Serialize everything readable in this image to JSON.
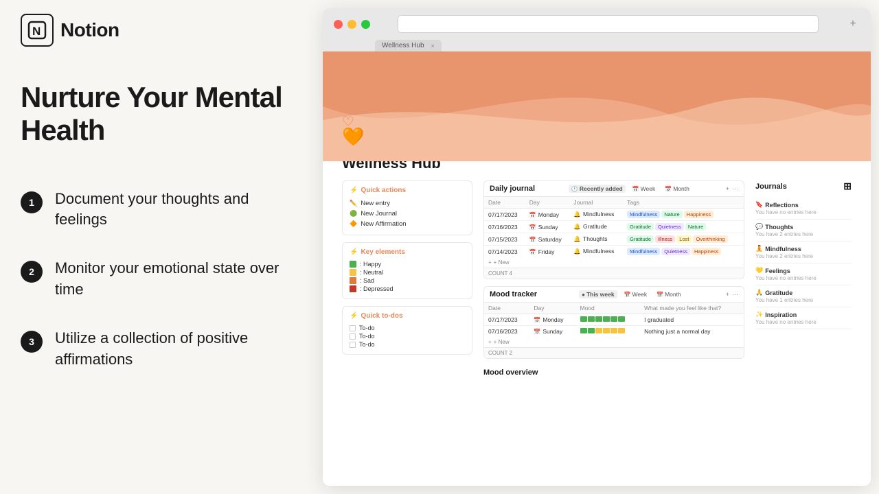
{
  "logo": {
    "icon_text": "N",
    "text": "Notion"
  },
  "heading": "Nurture Your Mental Health",
  "features": [
    {
      "number": "1",
      "text": "Document your thoughts and feelings"
    },
    {
      "number": "2",
      "text": "Monitor your emotional state over time"
    },
    {
      "number": "3",
      "text": "Utilize a collection of positive affirmations"
    }
  ],
  "browser": {
    "tab_label": "Wellness Hub",
    "tab_close": "×",
    "tab_add": "+"
  },
  "notion_page": {
    "title": "Wellness Hub",
    "quick_actions": {
      "title": "Quick actions",
      "items": [
        {
          "icon": "✏️",
          "label": "New entry"
        },
        {
          "icon": "🟢",
          "label": "New Journal"
        },
        {
          "icon": "🔶",
          "label": "New Affirmation"
        }
      ]
    },
    "key_elements": {
      "title": "Key elements",
      "items": [
        {
          "color": "#4caf50",
          "label": ": Happy"
        },
        {
          "color": "#f5c542",
          "label": ": Neutral"
        },
        {
          "color": "#e07b39",
          "label": ": Sad"
        },
        {
          "color": "#c0392b",
          "label": ": Depressed"
        }
      ]
    },
    "quick_todos": {
      "title": "Quick to-dos",
      "items": [
        "To-do",
        "To-do",
        "To-do"
      ]
    },
    "daily_journal": {
      "title": "Daily journal",
      "tabs": [
        "Recently added",
        "Week",
        "Month"
      ],
      "columns": [
        "Date",
        "Day",
        "Journal",
        "Tags"
      ],
      "rows": [
        {
          "date": "07/17/2023",
          "day": "Monday",
          "journal": "Mindfulness",
          "tags": [
            "Mindfulness",
            "Nature",
            "Happiness"
          ],
          "tag_styles": [
            "blue",
            "green",
            "orange"
          ]
        },
        {
          "date": "07/16/2023",
          "day": "Sunday",
          "journal": "Gratitude",
          "tags": [
            "Gratitude",
            "Quietness",
            "Nature"
          ],
          "tag_styles": [
            "green",
            "purple",
            "green"
          ]
        },
        {
          "date": "07/15/2023",
          "day": "Saturday",
          "journal": "Thoughts",
          "tags": [
            "Gratitude",
            "Illness",
            "Lost",
            "Overthinking"
          ],
          "tag_styles": [
            "green",
            "red",
            "yellow",
            "orange"
          ]
        },
        {
          "date": "07/14/2023",
          "day": "Friday",
          "journal": "Mindfulness",
          "tags": [
            "Mindfulness",
            "Quietness",
            "Happiness"
          ],
          "tag_styles": [
            "blue",
            "purple",
            "orange"
          ]
        }
      ],
      "count": "COUNT 4",
      "new_label": "+ New"
    },
    "mood_tracker": {
      "title": "Mood tracker",
      "tabs": [
        "This week",
        "Week",
        "Month"
      ],
      "columns": [
        "Date",
        "Day",
        "Mood",
        "What made you feel like that?"
      ],
      "rows": [
        {
          "date": "07/17/2023",
          "day": "Monday",
          "mood": [
            "#4caf50",
            "#4caf50",
            "#4caf50",
            "#4caf50",
            "#4caf50",
            "#4caf50"
          ],
          "note": "I graduated"
        },
        {
          "date": "07/16/2023",
          "day": "Sunday",
          "mood": [
            "#4caf50",
            "#4caf50",
            "#f5c542",
            "#f5c542",
            "#f5c542",
            "#f5c542"
          ],
          "note": "Nothing just a normal day"
        }
      ],
      "count": "COUNT 2",
      "new_label": "+ New"
    },
    "mood_overview": {
      "title": "Mood overview"
    },
    "journals": {
      "title": "Journals",
      "entries": [
        {
          "icon": "🔖",
          "name": "Reflections",
          "sub": "You have no entries here"
        },
        {
          "icon": "💬",
          "name": "Thoughts",
          "sub": "You have 2 entries here"
        },
        {
          "icon": "🧘",
          "name": "Mindfulness",
          "sub": "You have 2 entries here"
        },
        {
          "icon": "💛",
          "name": "Feelings",
          "sub": "You have no entries here"
        },
        {
          "icon": "🙏",
          "name": "Gratitude",
          "sub": "You have 1 entries here"
        },
        {
          "icon": "✨",
          "name": "Inspiration",
          "sub": "You have no entries here"
        }
      ]
    }
  }
}
